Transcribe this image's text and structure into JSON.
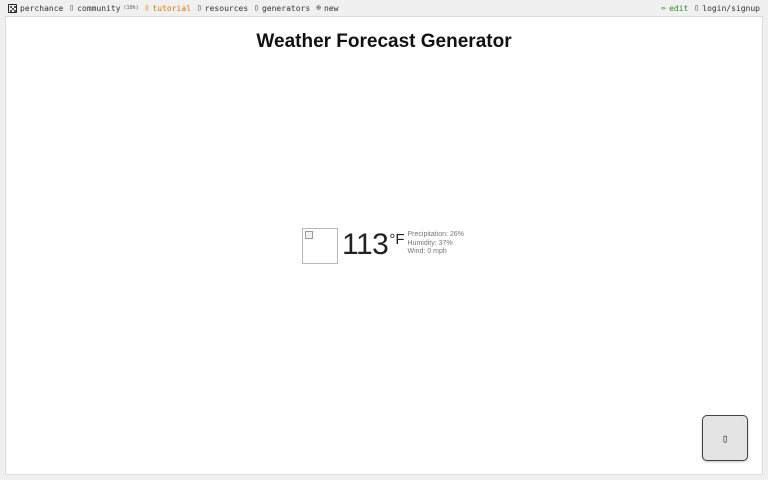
{
  "topnav": {
    "left": [
      {
        "icon": "dice-icon",
        "label": "perchance"
      },
      {
        "icon": "community-icon",
        "label": "community",
        "badge": "(10h)"
      },
      {
        "icon": "tutorial-icon",
        "label": "tutorial"
      },
      {
        "icon": "resources-icon",
        "label": "resources"
      },
      {
        "icon": "generators-icon",
        "label": "generators"
      },
      {
        "icon": "plus-circle-icon",
        "label": "new"
      }
    ],
    "right": [
      {
        "icon": "pencil-icon",
        "label": "edit"
      },
      {
        "icon": "login-icon",
        "label": "login/signup"
      }
    ]
  },
  "page": {
    "title": "Weather Forecast Generator"
  },
  "weather": {
    "temperature": "113",
    "unit": "°F",
    "precipitation": "Precipitation: 26%",
    "humidity": "Humidity: 37%",
    "wind": "Wind: 0 mph"
  },
  "colors": {
    "tutorial": "#e07800",
    "edit": "#2a8a2a",
    "panel_bg": "#ffffff",
    "page_bg": "#f0f0f0"
  }
}
